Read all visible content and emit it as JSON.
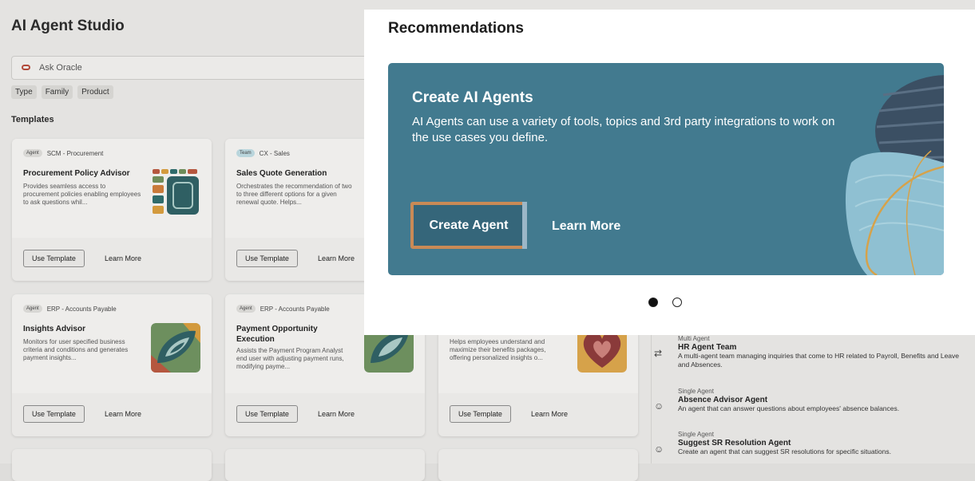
{
  "app": {
    "title": "AI Agent Studio"
  },
  "search": {
    "placeholder": "Ask Oracle"
  },
  "filters": [
    "Type",
    "Family",
    "Product"
  ],
  "templates_label": "Templates",
  "cards": [
    {
      "tag": "Agent",
      "family": "SCM - Procurement",
      "title": "Procurement Policy Advisor",
      "desc": "Provides seamless access to procurement policies enabling employees to ask questions whil...",
      "use_label": "Use Template",
      "more_label": "Learn More"
    },
    {
      "tag": "Team",
      "family": "CX - Sales",
      "title": "Sales Quote Generation",
      "desc": "Orchestrates the recommendation of two to three different options for a given renewal quote. Helps...",
      "use_label": "Use Template",
      "more_label": "Learn More"
    },
    {
      "tag": "Agent",
      "family": "ERP - Accounts Payable",
      "title": "Insights Advisor",
      "desc": "Monitors for user specified business criteria and conditions and generates payment insights...",
      "use_label": "Use Template",
      "more_label": "Learn More"
    },
    {
      "tag": "Agent",
      "family": "ERP - Accounts Payable",
      "title": "Payment Opportunity Execution",
      "desc": "Assists the Payment Program Analyst end user with adjusting payment runs, modifying payme...",
      "use_label": "Use Template",
      "more_label": "Learn More"
    },
    {
      "desc": "Helps employees understand and maximize their benefits packages, offering personalized insights o...",
      "use_label": "Use Template",
      "more_label": "Learn More"
    }
  ],
  "agents": [
    {
      "kind": "Multi Agent",
      "name": "HR Agent Team",
      "desc": "A multi-agent team managing inquiries that come to HR related to Payroll, Benefits and Leave and Absences."
    },
    {
      "kind": "Single Agent",
      "name": "Absence Advisor Agent",
      "desc": "An agent that can answer questions about employees' absence balances."
    },
    {
      "kind": "Single Agent",
      "name": "Suggest SR Resolution Agent",
      "desc": "Create an agent that can suggest SR resolutions for specific situations."
    }
  ],
  "modal": {
    "title": "Recommendations",
    "banner": {
      "heading": "Create AI Agents",
      "description": "AI Agents can use a variety of tools, topics and 3rd party integrations to work on the use cases you define.",
      "primary_label": "Create Agent",
      "secondary_label": "Learn More",
      "color": "#427a8f"
    },
    "carousel": {
      "current": 1,
      "total": 2
    }
  }
}
